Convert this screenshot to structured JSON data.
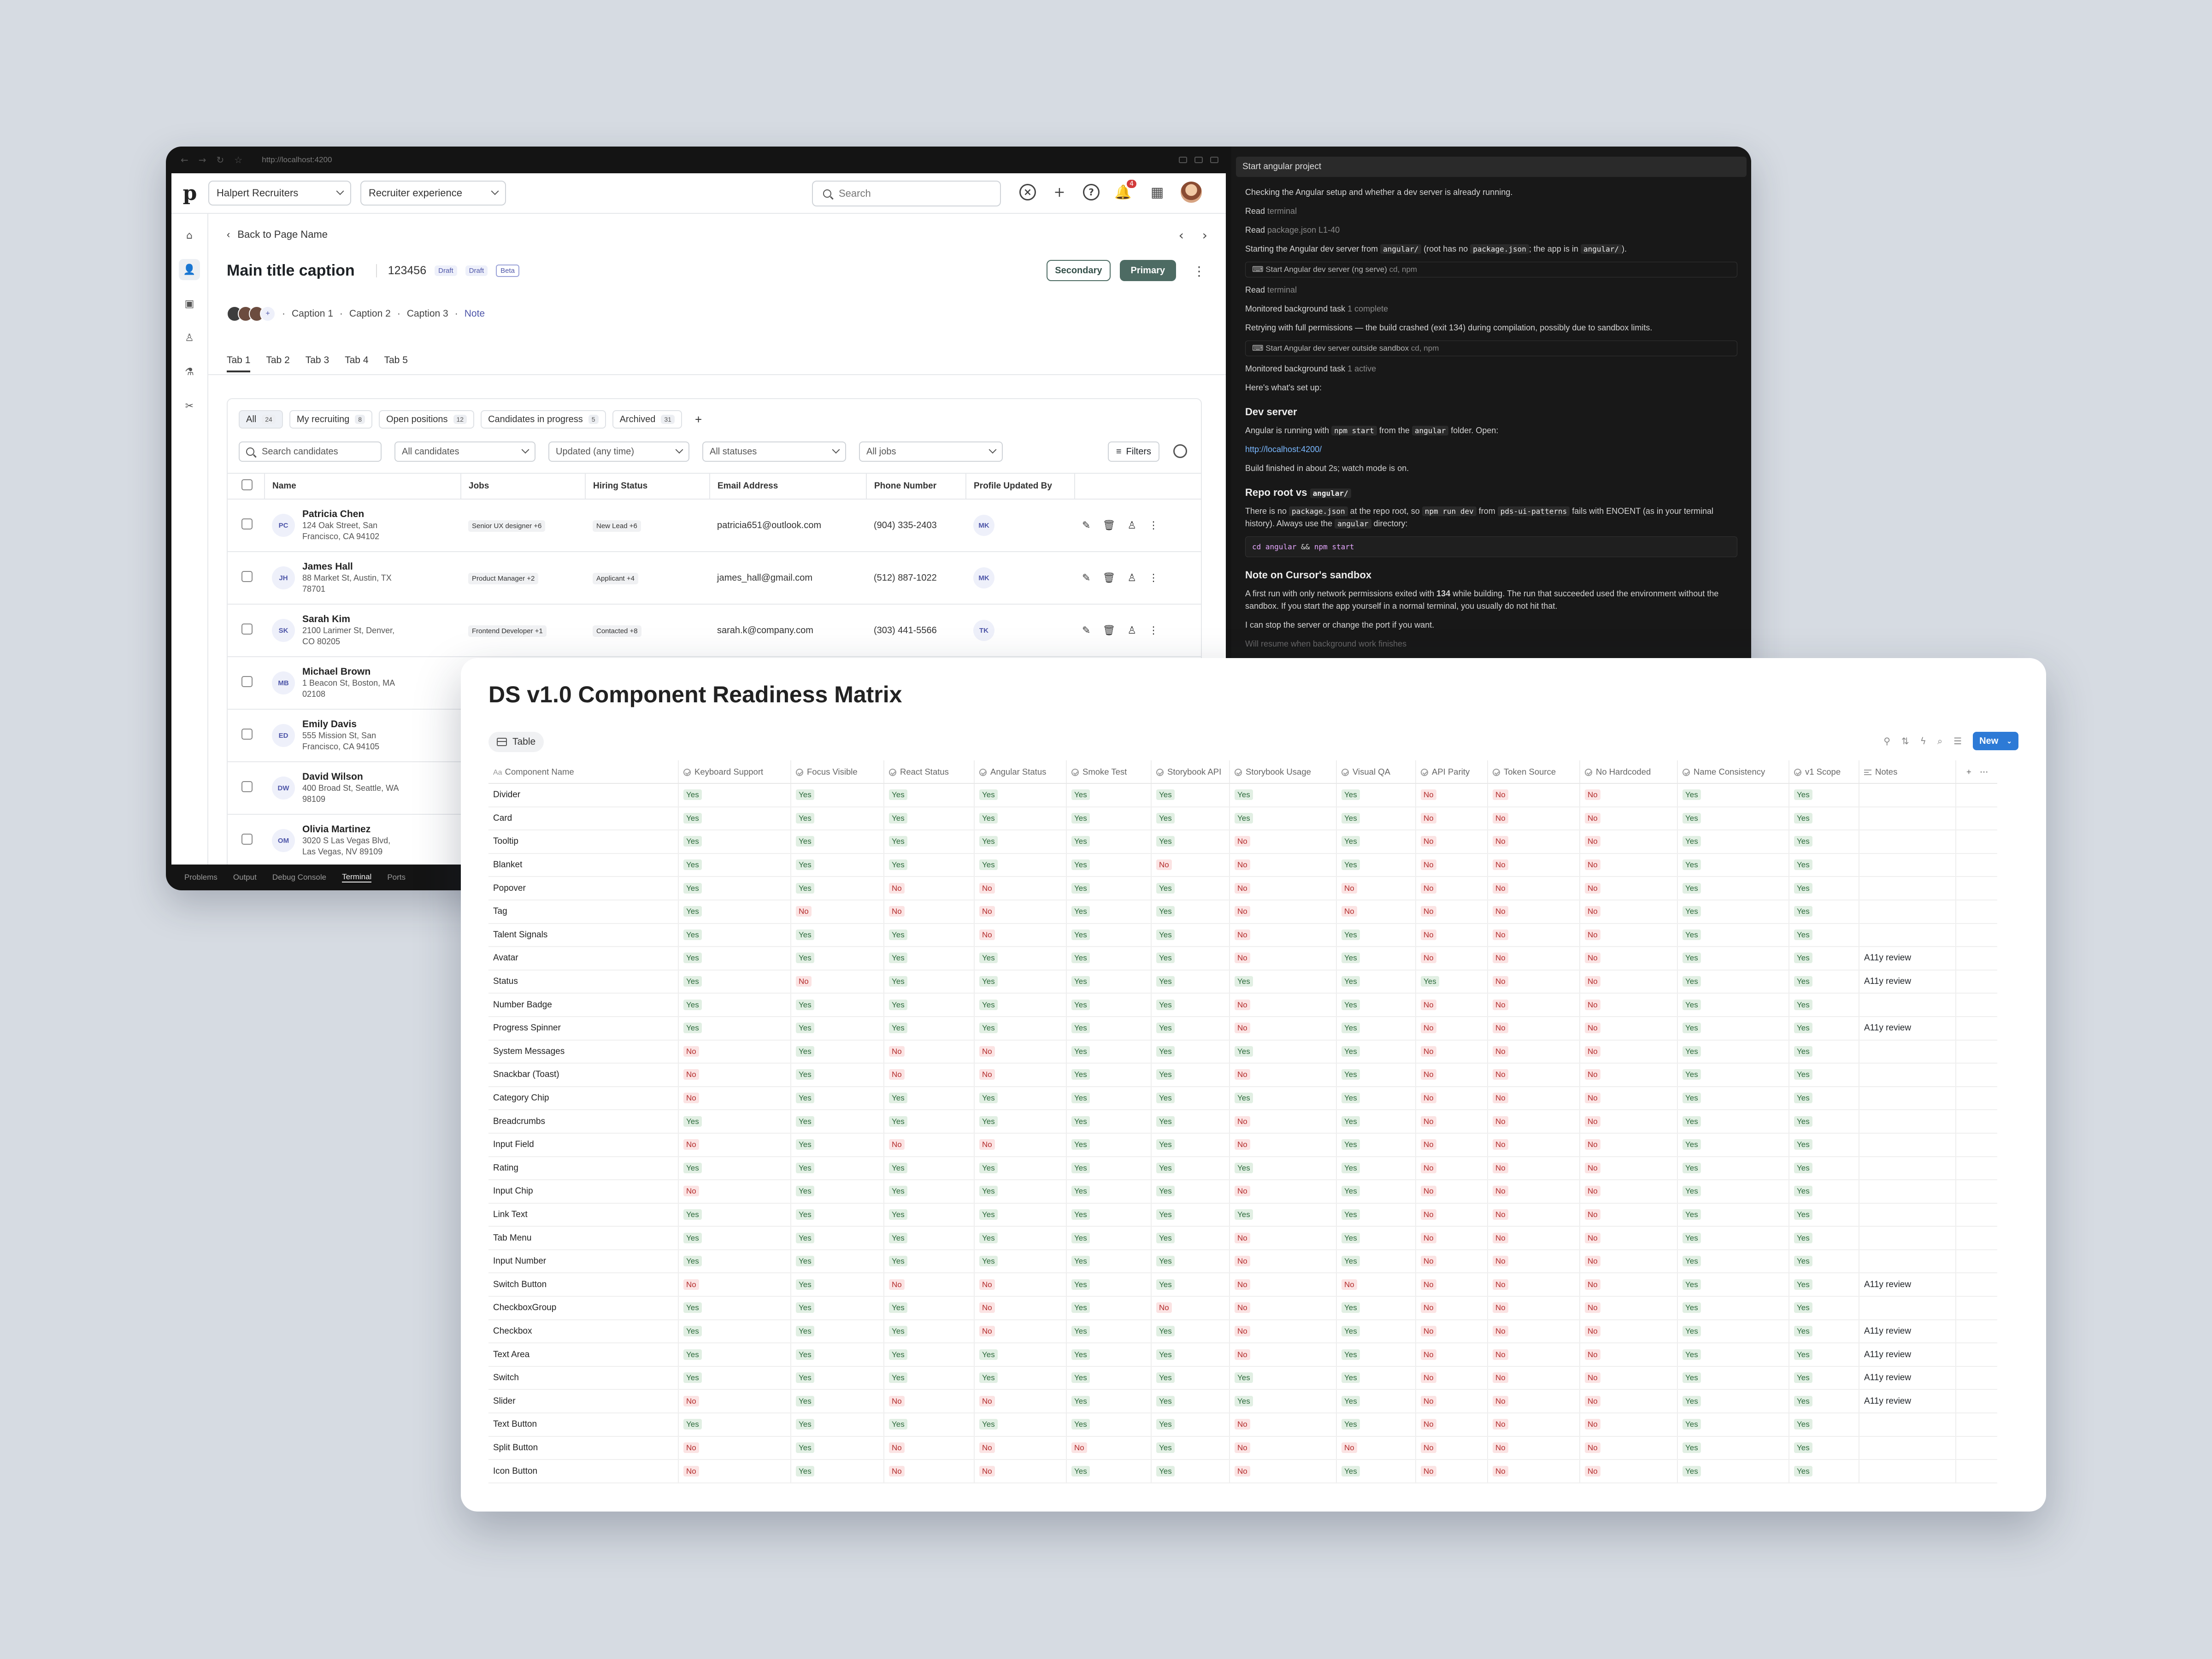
{
  "browser": {
    "url": "http://localhost:4200"
  },
  "app": {
    "logo": "p",
    "org_select": "Halpert Recruiters",
    "experience_select": "Recruiter experience",
    "search_placeholder": "Search",
    "notification_count": "4",
    "back_label": "Back to Page Name",
    "title": "Main title caption",
    "record_id": "123456",
    "tags": [
      "Draft",
      "Draft",
      "Beta"
    ],
    "secondary_label": "Secondary",
    "primary_label": "Primary",
    "avatar_more": "+",
    "captions": [
      "Caption 1",
      "Caption 2",
      "Caption 3"
    ],
    "note_label": "Note",
    "tabs": [
      "Tab 1",
      "Tab 2",
      "Tab 3",
      "Tab 4",
      "Tab 5"
    ],
    "filter_chips": [
      {
        "label": "All",
        "count": "24"
      },
      {
        "label": "My recruiting",
        "count": "8"
      },
      {
        "label": "Open positions",
        "count": "12"
      },
      {
        "label": "Candidates in progress",
        "count": "5"
      },
      {
        "label": "Archived",
        "count": "31"
      }
    ],
    "add_chip": "+",
    "search_candidates_placeholder": "Search candidates",
    "filters": [
      "All candidates",
      "Updated (any time)",
      "All statuses",
      "All jobs"
    ],
    "filters_button": "Filters",
    "columns": [
      "Name",
      "Jobs",
      "Hiring Status",
      "Email Address",
      "Phone Number",
      "Profile Updated By"
    ],
    "rows": [
      {
        "initials": "PC",
        "name": "Patricia Chen",
        "address": "124 Oak Street, San Francisco, CA 94102",
        "job": "Senior UX designer +6",
        "status": "New Lead +6",
        "email": "patricia651@outlook.com",
        "phone": "(904) 335-2403",
        "by": "MK"
      },
      {
        "initials": "JH",
        "name": "James Hall",
        "address": "88 Market St, Austin, TX 78701",
        "job": "Product Manager +2",
        "status": "Applicant +4",
        "email": "james_hall@gmail.com",
        "phone": "(512) 887-1022",
        "by": "MK"
      },
      {
        "initials": "SK",
        "name": "Sarah Kim",
        "address": "2100 Larimer St, Denver, CO 80205",
        "job": "Frontend Developer +1",
        "status": "Contacted +8",
        "email": "sarah.k@company.com",
        "phone": "(303) 441-5566",
        "by": "TK"
      },
      {
        "initials": "MB",
        "name": "Michael Brown",
        "address": "1 Beacon St, Boston, MA 02108",
        "job": "",
        "status": "",
        "email": "",
        "phone": "",
        "by": ""
      },
      {
        "initials": "ED",
        "name": "Emily Davis",
        "address": "555 Mission St, San Francisco, CA 94105",
        "job": "",
        "status": "",
        "email": "",
        "phone": "",
        "by": ""
      },
      {
        "initials": "DW",
        "name": "David Wilson",
        "address": "400 Broad St, Seattle, WA 98109",
        "job": "",
        "status": "",
        "email": "",
        "phone": "",
        "by": ""
      },
      {
        "initials": "OM",
        "name": "Olivia Martinez",
        "address": "3020 S Las Vegas Blvd, Las Vegas, NV 89109",
        "job": "",
        "status": "",
        "email": "",
        "phone": "",
        "by": ""
      }
    ]
  },
  "status_tabs": [
    "Problems",
    "Output",
    "Debug Console",
    "Terminal",
    "Ports"
  ],
  "agent": {
    "header": "Start angular project",
    "line1": "Checking the Angular setup and whether a dev server is already running.",
    "read1": [
      "Read",
      "terminal"
    ],
    "read2": [
      "Read",
      "package.json L1-40"
    ],
    "starting": [
      "Starting the Angular dev server from ",
      "angular/",
      " (root has no ",
      "package.json",
      "; the app is in ",
      "angular/",
      ")."
    ],
    "box1": [
      "Start Angular dev server (ng serve)",
      "cd, npm"
    ],
    "read3": [
      "Read",
      "terminal"
    ],
    "monitored1": [
      "Monitored background task",
      "1 complete"
    ],
    "retry": "Retrying with full permissions — the build crashed (exit 134) during compilation, possibly due to sandbox limits.",
    "box2": [
      "Start Angular dev server outside sandbox",
      "cd, npm"
    ],
    "monitored2": [
      "Monitored background task",
      "1 active"
    ],
    "setup": "Here's what's set up:",
    "h_dev": "Dev server",
    "dev_line": [
      "Angular is running with ",
      "npm start",
      " from the ",
      "angular",
      " folder. Open:"
    ],
    "dev_link": "http://localhost:4200/",
    "build_line": "Build finished in about 2s; watch mode is on.",
    "h_repo": [
      "Repo root vs ",
      "angular/"
    ],
    "repo_line": [
      "There is no ",
      "package.json",
      " at the repo root, so ",
      "npm run dev",
      " from ",
      "pds-ui-patterns",
      " fails with ENOENT (as in your terminal history). Always use the ",
      "angular",
      " directory:"
    ],
    "cmd": [
      "cd angular",
      " && ",
      "npm start"
    ],
    "h_sandbox": "Note on Cursor's sandbox",
    "sandbox_line": [
      "A first run with only network permissions exited with ",
      "134",
      " while building. The run that succeeded used the environment without the sandbox. If you start the app yourself in a normal terminal, you usually do not hit that."
    ],
    "stop_line": "I can stop the server or change the port if you want.",
    "resume": "Will resume when background work finishes"
  },
  "matrix": {
    "title": "DS v1.0 Component Readiness Matrix",
    "view_label": "Table",
    "new_label": "New",
    "columns": [
      "Component Name",
      "Keyboard Support",
      "Focus Visible",
      "React Status",
      "Angular Status",
      "Smoke Test",
      "Storybook API",
      "Storybook Usage",
      "Visual QA",
      "API Parity",
      "Token Source",
      "No Hardcoded",
      "Name Consistency",
      "v1 Scope",
      "Notes"
    ],
    "rows": [
      [
        "Divider",
        "Yes",
        "Yes",
        "Yes",
        "Yes",
        "Yes",
        "Yes",
        "Yes",
        "Yes",
        "No",
        "No",
        "No",
        "Yes",
        "Yes",
        ""
      ],
      [
        "Card",
        "Yes",
        "Yes",
        "Yes",
        "Yes",
        "Yes",
        "Yes",
        "Yes",
        "Yes",
        "No",
        "No",
        "No",
        "Yes",
        "Yes",
        ""
      ],
      [
        "Tooltip",
        "Yes",
        "Yes",
        "Yes",
        "Yes",
        "Yes",
        "Yes",
        "No",
        "Yes",
        "No",
        "No",
        "No",
        "Yes",
        "Yes",
        ""
      ],
      [
        "Blanket",
        "Yes",
        "Yes",
        "Yes",
        "Yes",
        "Yes",
        "No",
        "No",
        "Yes",
        "No",
        "No",
        "No",
        "Yes",
        "Yes",
        ""
      ],
      [
        "Popover",
        "Yes",
        "Yes",
        "No",
        "No",
        "Yes",
        "Yes",
        "No",
        "No",
        "No",
        "No",
        "No",
        "Yes",
        "Yes",
        ""
      ],
      [
        "Tag",
        "Yes",
        "No",
        "No",
        "No",
        "Yes",
        "Yes",
        "No",
        "No",
        "No",
        "No",
        "No",
        "Yes",
        "Yes",
        ""
      ],
      [
        "Talent Signals",
        "Yes",
        "Yes",
        "Yes",
        "No",
        "Yes",
        "Yes",
        "No",
        "Yes",
        "No",
        "No",
        "No",
        "Yes",
        "Yes",
        ""
      ],
      [
        "Avatar",
        "Yes",
        "Yes",
        "Yes",
        "Yes",
        "Yes",
        "Yes",
        "No",
        "Yes",
        "No",
        "No",
        "No",
        "Yes",
        "Yes",
        "A11y review"
      ],
      [
        "Status",
        "Yes",
        "No",
        "Yes",
        "Yes",
        "Yes",
        "Yes",
        "Yes",
        "Yes",
        "Yes",
        "No",
        "No",
        "Yes",
        "Yes",
        "A11y review"
      ],
      [
        "Number Badge",
        "Yes",
        "Yes",
        "Yes",
        "Yes",
        "Yes",
        "Yes",
        "No",
        "Yes",
        "No",
        "No",
        "No",
        "Yes",
        "Yes",
        ""
      ],
      [
        "Progress Spinner",
        "Yes",
        "Yes",
        "Yes",
        "Yes",
        "Yes",
        "Yes",
        "No",
        "Yes",
        "No",
        "No",
        "No",
        "Yes",
        "Yes",
        "A11y review"
      ],
      [
        "System Messages",
        "No",
        "Yes",
        "No",
        "No",
        "Yes",
        "Yes",
        "Yes",
        "Yes",
        "No",
        "No",
        "No",
        "Yes",
        "Yes",
        ""
      ],
      [
        "Snackbar (Toast)",
        "No",
        "Yes",
        "No",
        "No",
        "Yes",
        "Yes",
        "No",
        "Yes",
        "No",
        "No",
        "No",
        "Yes",
        "Yes",
        ""
      ],
      [
        "Category Chip",
        "No",
        "Yes",
        "Yes",
        "Yes",
        "Yes",
        "Yes",
        "Yes",
        "Yes",
        "No",
        "No",
        "No",
        "Yes",
        "Yes",
        ""
      ],
      [
        "Breadcrumbs",
        "Yes",
        "Yes",
        "Yes",
        "Yes",
        "Yes",
        "Yes",
        "No",
        "Yes",
        "No",
        "No",
        "No",
        "Yes",
        "Yes",
        ""
      ],
      [
        "Input Field",
        "No",
        "Yes",
        "No",
        "No",
        "Yes",
        "Yes",
        "No",
        "Yes",
        "No",
        "No",
        "No",
        "Yes",
        "Yes",
        ""
      ],
      [
        "Rating",
        "Yes",
        "Yes",
        "Yes",
        "Yes",
        "Yes",
        "Yes",
        "Yes",
        "Yes",
        "No",
        "No",
        "No",
        "Yes",
        "Yes",
        ""
      ],
      [
        "Input Chip",
        "No",
        "Yes",
        "Yes",
        "Yes",
        "Yes",
        "Yes",
        "No",
        "Yes",
        "No",
        "No",
        "No",
        "Yes",
        "Yes",
        ""
      ],
      [
        "Link Text",
        "Yes",
        "Yes",
        "Yes",
        "Yes",
        "Yes",
        "Yes",
        "Yes",
        "Yes",
        "No",
        "No",
        "No",
        "Yes",
        "Yes",
        ""
      ],
      [
        "Tab Menu",
        "Yes",
        "Yes",
        "Yes",
        "Yes",
        "Yes",
        "Yes",
        "No",
        "Yes",
        "No",
        "No",
        "No",
        "Yes",
        "Yes",
        ""
      ],
      [
        "Input Number",
        "Yes",
        "Yes",
        "Yes",
        "Yes",
        "Yes",
        "Yes",
        "No",
        "Yes",
        "No",
        "No",
        "No",
        "Yes",
        "Yes",
        ""
      ],
      [
        "Switch Button",
        "No",
        "Yes",
        "No",
        "No",
        "Yes",
        "Yes",
        "No",
        "No",
        "No",
        "No",
        "No",
        "Yes",
        "Yes",
        "A11y review"
      ],
      [
        "CheckboxGroup",
        "Yes",
        "Yes",
        "Yes",
        "No",
        "Yes",
        "No",
        "No",
        "Yes",
        "No",
        "No",
        "No",
        "Yes",
        "Yes",
        ""
      ],
      [
        "Checkbox",
        "Yes",
        "Yes",
        "Yes",
        "No",
        "Yes",
        "Yes",
        "No",
        "Yes",
        "No",
        "No",
        "No",
        "Yes",
        "Yes",
        "A11y review"
      ],
      [
        "Text Area",
        "Yes",
        "Yes",
        "Yes",
        "Yes",
        "Yes",
        "Yes",
        "No",
        "Yes",
        "No",
        "No",
        "No",
        "Yes",
        "Yes",
        "A11y review"
      ],
      [
        "Switch",
        "Yes",
        "Yes",
        "Yes",
        "Yes",
        "Yes",
        "Yes",
        "Yes",
        "Yes",
        "No",
        "No",
        "No",
        "Yes",
        "Yes",
        "A11y review"
      ],
      [
        "Slider",
        "No",
        "Yes",
        "No",
        "No",
        "Yes",
        "Yes",
        "Yes",
        "Yes",
        "No",
        "No",
        "No",
        "Yes",
        "Yes",
        "A11y review"
      ],
      [
        "Text Button",
        "Yes",
        "Yes",
        "Yes",
        "Yes",
        "Yes",
        "Yes",
        "No",
        "Yes",
        "No",
        "No",
        "No",
        "Yes",
        "Yes",
        ""
      ],
      [
        "Split Button",
        "No",
        "Yes",
        "No",
        "No",
        "No",
        "Yes",
        "No",
        "No",
        "No",
        "No",
        "No",
        "Yes",
        "Yes",
        ""
      ],
      [
        "Icon Button",
        "No",
        "Yes",
        "No",
        "No",
        "Yes",
        "Yes",
        "No",
        "Yes",
        "No",
        "No",
        "No",
        "Yes",
        "Yes",
        ""
      ]
    ]
  }
}
